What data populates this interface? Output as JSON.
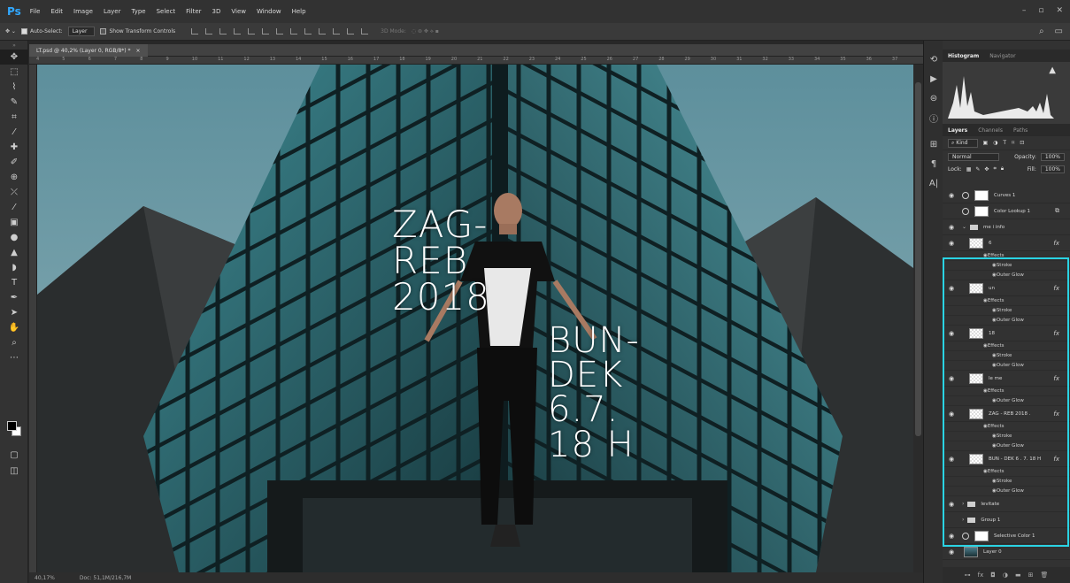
{
  "app": {
    "logo": "Ps"
  },
  "menu": [
    "File",
    "Edit",
    "Image",
    "Layer",
    "Type",
    "Select",
    "Filter",
    "3D",
    "View",
    "Window",
    "Help"
  ],
  "window_controls": {
    "minimize": "–",
    "restore": "▫",
    "close": "✕"
  },
  "options": {
    "auto_select_label": "Auto-Select:",
    "auto_select_value": "Layer",
    "show_transform_label": "Show Transform Controls",
    "mode_3d_label": "3D Mode:"
  },
  "document": {
    "tab_title": "LT.psd @ 40,2% (Layer 0, RGB/8*) *",
    "tab_close": "×",
    "ruler_numbers": [
      "4",
      "5",
      "6",
      "7",
      "8",
      "9",
      "10",
      "11",
      "12",
      "13",
      "14",
      "15",
      "16",
      "17",
      "18",
      "19",
      "20",
      "21",
      "22",
      "23",
      "24",
      "25",
      "26",
      "27",
      "28",
      "29",
      "30",
      "31",
      "32",
      "33",
      "34",
      "35",
      "36",
      "37"
    ],
    "status_zoom": "40,17%",
    "status_doc": "Doc: 51,1M/216,7M"
  },
  "poster": {
    "left_text": "ZAG-\nREB\n2018",
    "right_text": "BUN-\nDEK\n6.7.\n18 H"
  },
  "panels": {
    "top_tabs": [
      "Histogram",
      "Navigator"
    ],
    "layer_tabs": [
      "Layers",
      "Channels",
      "Paths"
    ],
    "kind_label": "Kind",
    "blend_mode": "Normal",
    "opacity_label": "Opacity:",
    "opacity_value": "100%",
    "lock_label": "Lock:",
    "fill_label": "Fill:",
    "fill_value": "100%"
  },
  "layers": [
    {
      "name": "Curves 1"
    },
    {
      "name": "Color Lookup 1"
    },
    {
      "name": "me i info"
    },
    {
      "name": "6"
    },
    {
      "name": "un"
    },
    {
      "name": "18"
    },
    {
      "name": "le me"
    },
    {
      "name": "ZAG - REB 2018 ."
    },
    {
      "name": "BUN - DEK 6 . 7. 18 H"
    },
    {
      "name": "levitate"
    },
    {
      "name": "Group 1"
    },
    {
      "name": "Selective Color 1"
    },
    {
      "name": "Layer 0"
    }
  ],
  "effects": {
    "header": "Effects",
    "stroke": "Stroke",
    "outer_glow": "Outer Glow"
  },
  "colors": {
    "highlight": "#2ad3e3",
    "sky": "#6c9ba7",
    "glass": "#3a7a82"
  }
}
